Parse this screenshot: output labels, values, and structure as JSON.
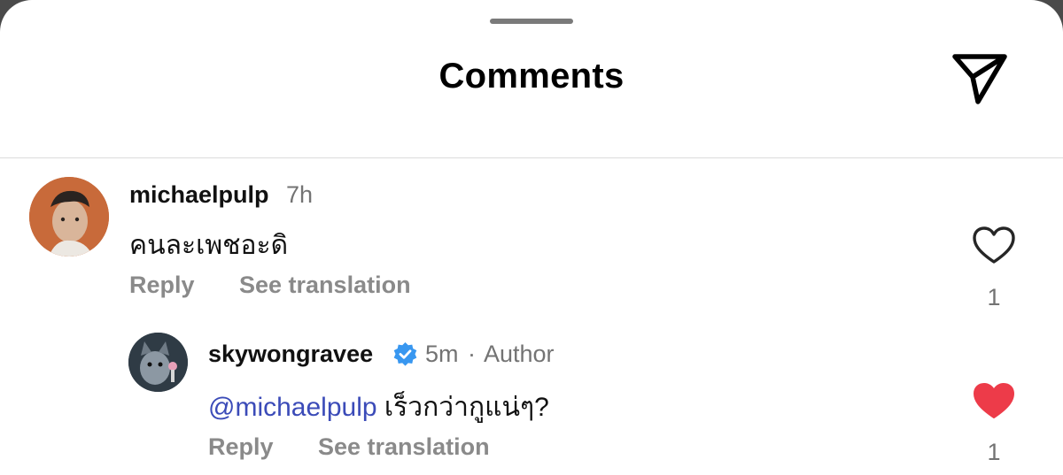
{
  "header": {
    "title": "Comments",
    "send_icon": "send-paper-plane-icon"
  },
  "comments": [
    {
      "username": "michaelpulp",
      "time": "7h",
      "text": "คนละเพชอะดิ",
      "reply_label": "Reply",
      "translation_label": "See translation",
      "likes": "1",
      "liked": false
    }
  ],
  "replies": [
    {
      "username": "skywongravee",
      "verified": true,
      "time": "5m",
      "separator": "·",
      "author_tag": "Author",
      "mention": "@michaelpulp",
      "text": "เร็วกว่ากูแน่ๆ?",
      "reply_label": "Reply",
      "translation_label": "See translation",
      "likes": "1",
      "liked": true
    }
  ],
  "colors": {
    "heart_liked": "#ed3b49",
    "mention": "#3b4bb8",
    "verified": "#3897f0"
  }
}
